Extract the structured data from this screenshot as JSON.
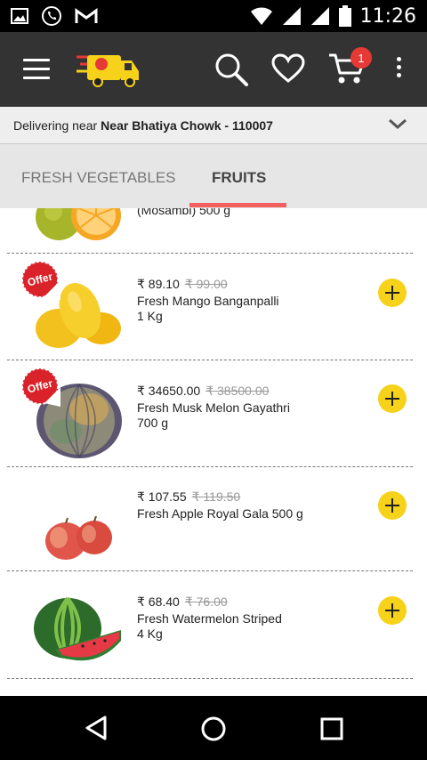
{
  "status_bar": {
    "time": "11:26"
  },
  "cart": {
    "count": "1"
  },
  "location": {
    "prefix": "Delivering near",
    "place": "Near Bhatiya Chowk - 110007"
  },
  "tabs": [
    {
      "label": "FRESH VEGETABLES"
    },
    {
      "label": "FRUITS"
    }
  ],
  "products": [
    {
      "name": "(Mosambi) 500 g"
    },
    {
      "badge": "Offer",
      "price": "₹ 89.10",
      "original_price": "₹ 99.00",
      "name": "Fresh Mango Banganpalli",
      "qty": "1 Kg"
    },
    {
      "badge": "Offer",
      "price": "₹ 34650.00",
      "original_price": "₹ 38500.00",
      "name": "Fresh Musk Melon Gayathri",
      "qty": "700 g"
    },
    {
      "price": "₹ 107.55",
      "original_price": "₹ 119.50",
      "name": "Fresh Apple Royal Gala 500 g"
    },
    {
      "price": "₹ 68.40",
      "original_price": "₹ 76.00",
      "name": "Fresh Watermelon Striped",
      "qty": "4 Kg"
    }
  ],
  "colors": {
    "app_bar": "#333333",
    "accent_tab": "#f06060",
    "add_button": "#f6d21b",
    "badge": "#e53935"
  },
  "icons": [
    "image-icon",
    "whatsapp-icon",
    "gmail-icon",
    "wifi-icon",
    "signal-icon",
    "battery-icon",
    "menu-icon",
    "delivery-truck-logo",
    "search-icon",
    "heart-icon",
    "cart-icon",
    "more-vert-icon",
    "chevron-down-icon",
    "add-icon",
    "back-icon",
    "home-icon",
    "recents-icon"
  ]
}
